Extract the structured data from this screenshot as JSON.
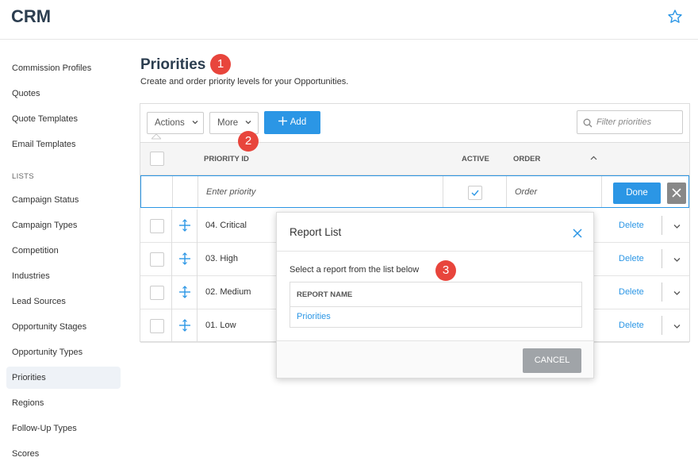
{
  "app": {
    "title": "CRM"
  },
  "sidebar": {
    "items_top": [
      {
        "label": "Commission Profiles"
      },
      {
        "label": "Quotes"
      },
      {
        "label": "Quote Templates"
      },
      {
        "label": "Email Templates"
      }
    ],
    "section_label": "LISTS",
    "list_items": [
      {
        "label": "Campaign Status"
      },
      {
        "label": "Campaign Types"
      },
      {
        "label": "Competition"
      },
      {
        "label": "Industries"
      },
      {
        "label": "Lead Sources"
      },
      {
        "label": "Opportunity Stages"
      },
      {
        "label": "Opportunity Types"
      },
      {
        "label": "Priorities",
        "active": true
      },
      {
        "label": "Regions"
      },
      {
        "label": "Follow-Up Types"
      },
      {
        "label": "Scores"
      }
    ]
  },
  "page": {
    "title": "Priorities",
    "description": "Create and order priority levels for your Opportunities."
  },
  "badges": [
    "1",
    "2",
    "3"
  ],
  "toolbar": {
    "actions_label": "Actions",
    "more_label": "More",
    "add_label": "Add",
    "filter_placeholder": "Filter priorities"
  },
  "table": {
    "columns": {
      "priority_id": "PRIORITY ID",
      "active": "ACTIVE",
      "order": "ORDER"
    },
    "edit_row": {
      "priority_placeholder": "Enter priority",
      "order_placeholder": "Order",
      "active_checked": true,
      "done_label": "Done"
    },
    "rows": [
      {
        "priority": "04. Critical",
        "action": "Delete"
      },
      {
        "priority": "03. High",
        "action": "Delete"
      },
      {
        "priority": "02. Medium",
        "action": "Delete"
      },
      {
        "priority": "01. Low",
        "action": "Delete"
      }
    ]
  },
  "modal": {
    "title": "Report List",
    "instruction": "Select a report from the list below",
    "column_header": "REPORT NAME",
    "reports": [
      "Priorities"
    ],
    "cancel_label": "CANCEL"
  },
  "colors": {
    "accent": "#2b96e5",
    "badge": "#e8453c",
    "title": "#2c3e50"
  }
}
